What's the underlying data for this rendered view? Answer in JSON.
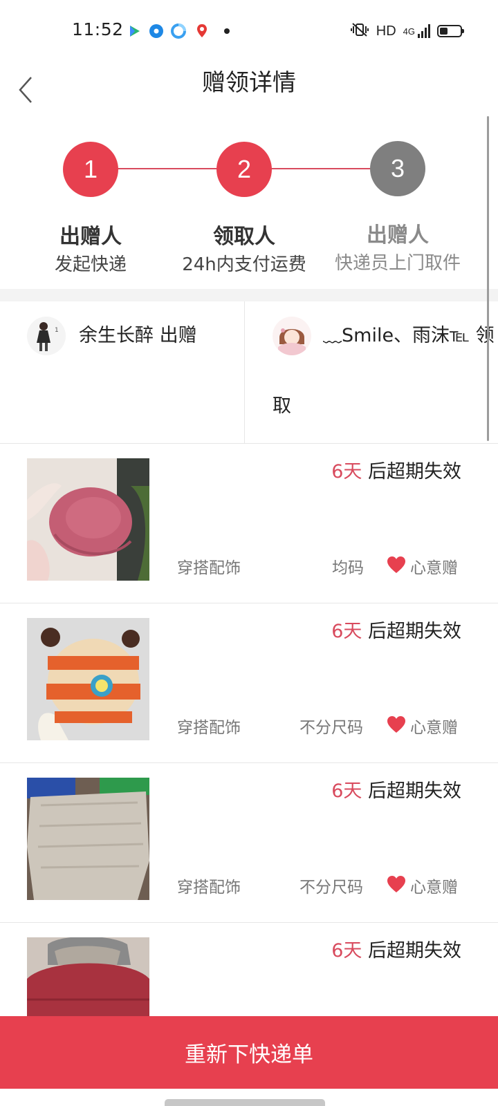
{
  "status_bar": {
    "time": "11:52",
    "hd": "HD",
    "network": "4G",
    "app_icons": [
      "video-app-icon",
      "blue-circle-app-icon",
      "cloud-app-icon",
      "map-pin-app-icon"
    ]
  },
  "header": {
    "title": "赠领详情"
  },
  "steps": [
    {
      "number": "1",
      "title": "出赠人",
      "subtitle": "发起快递",
      "state": "done"
    },
    {
      "number": "2",
      "title": "领取人",
      "subtitle": "24h内支付运费",
      "state": "done"
    },
    {
      "number": "3",
      "title": "出赠人",
      "subtitle": "快递员上门取件",
      "state": "pending"
    }
  ],
  "colors": {
    "accent": "#e7404f",
    "step_active": "#e7404f",
    "step_pending": "#7f7f7f",
    "expire_days": "#d84a5d"
  },
  "users": {
    "giver": "余生长醉 出赠",
    "receiver_line1": "﹏Smile、雨沫℡ 领",
    "receiver_line2": "取"
  },
  "items": [
    {
      "days": "6天",
      "expire_text": " 后超期失效",
      "category": "穿搭配饰",
      "size": "均码",
      "gift": "心意赠"
    },
    {
      "days": "6天",
      "expire_text": " 后超期失效",
      "category": "穿搭配饰",
      "size": "不分尺码",
      "gift": "心意赠"
    },
    {
      "days": "6天",
      "expire_text": " 后超期失效",
      "category": "穿搭配饰",
      "size": "不分尺码",
      "gift": "心意赠"
    },
    {
      "days": "6天",
      "expire_text": " 后超期失效"
    }
  ],
  "bottom_button": {
    "label": "重新下快递单"
  }
}
